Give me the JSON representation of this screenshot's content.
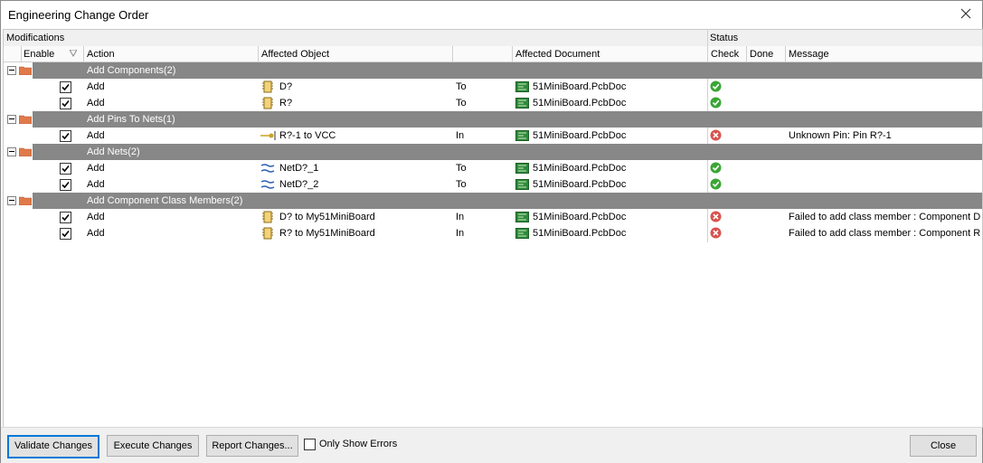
{
  "window": {
    "title": "Engineering Change Order"
  },
  "headers": {
    "group_modifications": "Modifications",
    "group_status": "Status",
    "enable": "Enable",
    "action": "Action",
    "affected_object": "Affected Object",
    "affected_document": "Affected Document",
    "check": "Check",
    "done": "Done",
    "message": "Message"
  },
  "groups": [
    {
      "label": "Add Components(2)"
    },
    {
      "label": "Add Pins To Nets(1)"
    },
    {
      "label": "Add Nets(2)"
    },
    {
      "label": "Add Component Class Members(2)"
    }
  ],
  "rows": [
    {
      "action": "Add",
      "object": "D?",
      "relation": "To",
      "document": "51MiniBoard.PcbDoc",
      "check": "ok",
      "message": ""
    },
    {
      "action": "Add",
      "object": "R?",
      "relation": "To",
      "document": "51MiniBoard.PcbDoc",
      "check": "ok",
      "message": ""
    },
    {
      "action": "Add",
      "object": "R?-1 to VCC",
      "relation": "In",
      "document": "51MiniBoard.PcbDoc",
      "check": "error",
      "message": "Unknown Pin: Pin R?-1"
    },
    {
      "action": "Add",
      "object": "NetD?_1",
      "relation": "To",
      "document": "51MiniBoard.PcbDoc",
      "check": "ok",
      "message": ""
    },
    {
      "action": "Add",
      "object": "NetD?_2",
      "relation": "To",
      "document": "51MiniBoard.PcbDoc",
      "check": "ok",
      "message": ""
    },
    {
      "action": "Add",
      "object": "D? to My51MiniBoard",
      "relation": "In",
      "document": "51MiniBoard.PcbDoc",
      "check": "error",
      "message": "Failed to add class member : Component D"
    },
    {
      "action": "Add",
      "object": "R? to My51MiniBoard",
      "relation": "In",
      "document": "51MiniBoard.PcbDoc",
      "check": "error",
      "message": "Failed to add class member : Component R"
    }
  ],
  "buttons": {
    "validate": "Validate Changes",
    "execute": "Execute Changes",
    "report": "Report Changes...",
    "only_errors": "Only Show Errors",
    "close": "Close"
  },
  "icons": {
    "component": "component-icon",
    "pin": "pin-icon",
    "net": "net-icon",
    "document": "pcb-document-icon",
    "ok": "check-ok-icon",
    "error": "check-error-icon",
    "folder": "folder-icon"
  },
  "colors": {
    "group_row": "#878787",
    "ok": "#3aa635",
    "error": "#d9534f",
    "primary_border": "#0078d7"
  }
}
